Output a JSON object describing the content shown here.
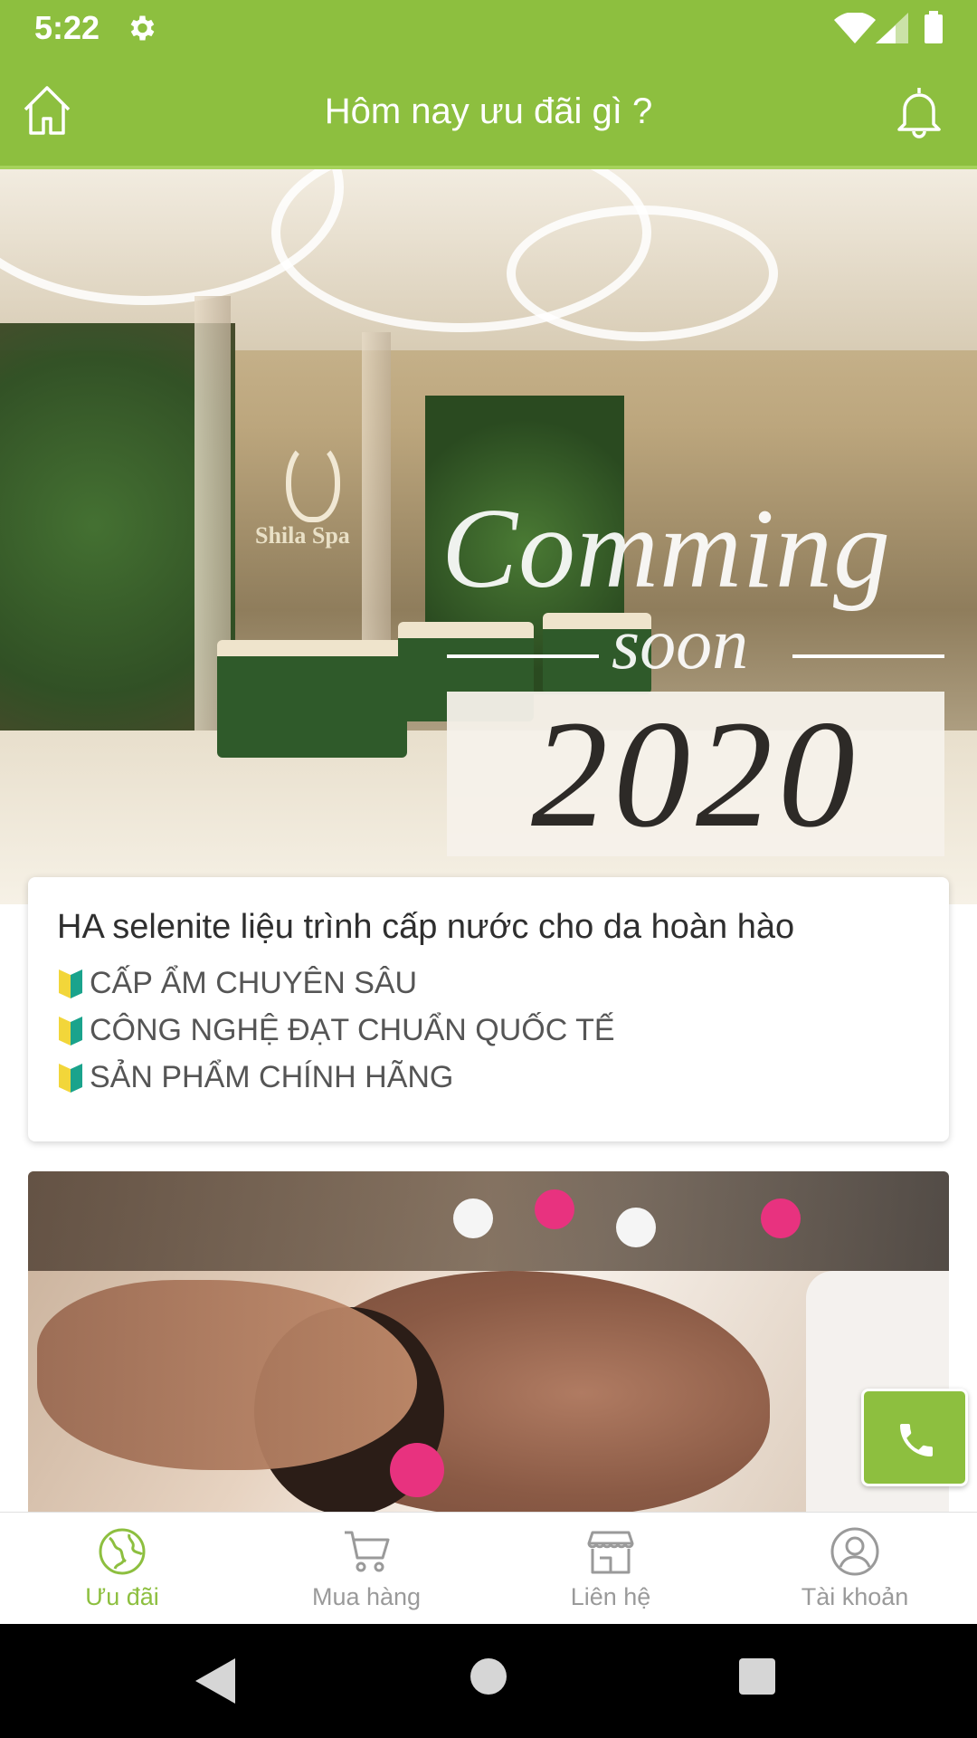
{
  "status_bar": {
    "time": "5:22"
  },
  "app_bar": {
    "title": "Hôm nay ưu đãi gì ?"
  },
  "hero": {
    "logo_text": "Shila Spa",
    "heading": "Comming",
    "subheading": "soon",
    "year": "2020"
  },
  "promo_card": {
    "title": "HA selenite liệu trình cấp nước cho da hoàn hào",
    "lines": [
      "CẤP ẨM CHUYÊN SÂU",
      "CÔNG NGHỆ ĐẠT CHUẨN QUỐC TẾ",
      "SẢN PHẨM CHÍNH HÃNG"
    ]
  },
  "bottom_nav": {
    "items": [
      {
        "label": "Ưu đãi",
        "icon": "globe-icon",
        "active": true
      },
      {
        "label": "Mua hàng",
        "icon": "cart-icon",
        "active": false
      },
      {
        "label": "Liên hệ",
        "icon": "store-icon",
        "active": false
      },
      {
        "label": "Tài khoản",
        "icon": "user-icon",
        "active": false
      }
    ]
  },
  "colors": {
    "primary": "#8dbf3f",
    "nav_inactive": "#9a9a9a"
  }
}
